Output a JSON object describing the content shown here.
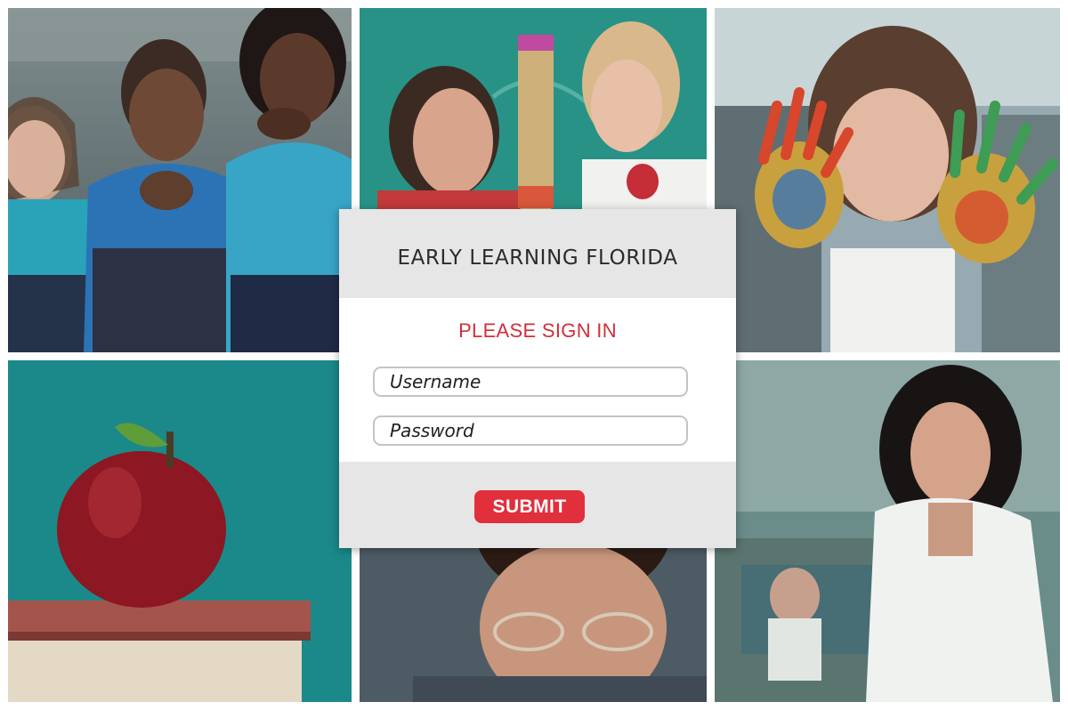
{
  "app": {
    "title": "EARLY LEARNING FLORIDA"
  },
  "login": {
    "heading": "PLEASE SIGN IN",
    "username_placeholder": "Username",
    "password_placeholder": "Password",
    "submit_label": "SUBMIT"
  },
  "colors": {
    "accent": "#e12f3c",
    "heading_red": "#d12f3a",
    "panel_gray": "#e6e6e6"
  },
  "photos": [
    {
      "name": "children-sitting-photo"
    },
    {
      "name": "teacher-and-girl-photo"
    },
    {
      "name": "painted-hands-girl-photo"
    },
    {
      "name": "apple-on-books-photo"
    },
    {
      "name": "boy-with-glasses-photo"
    },
    {
      "name": "smiling-teacher-photo"
    }
  ]
}
